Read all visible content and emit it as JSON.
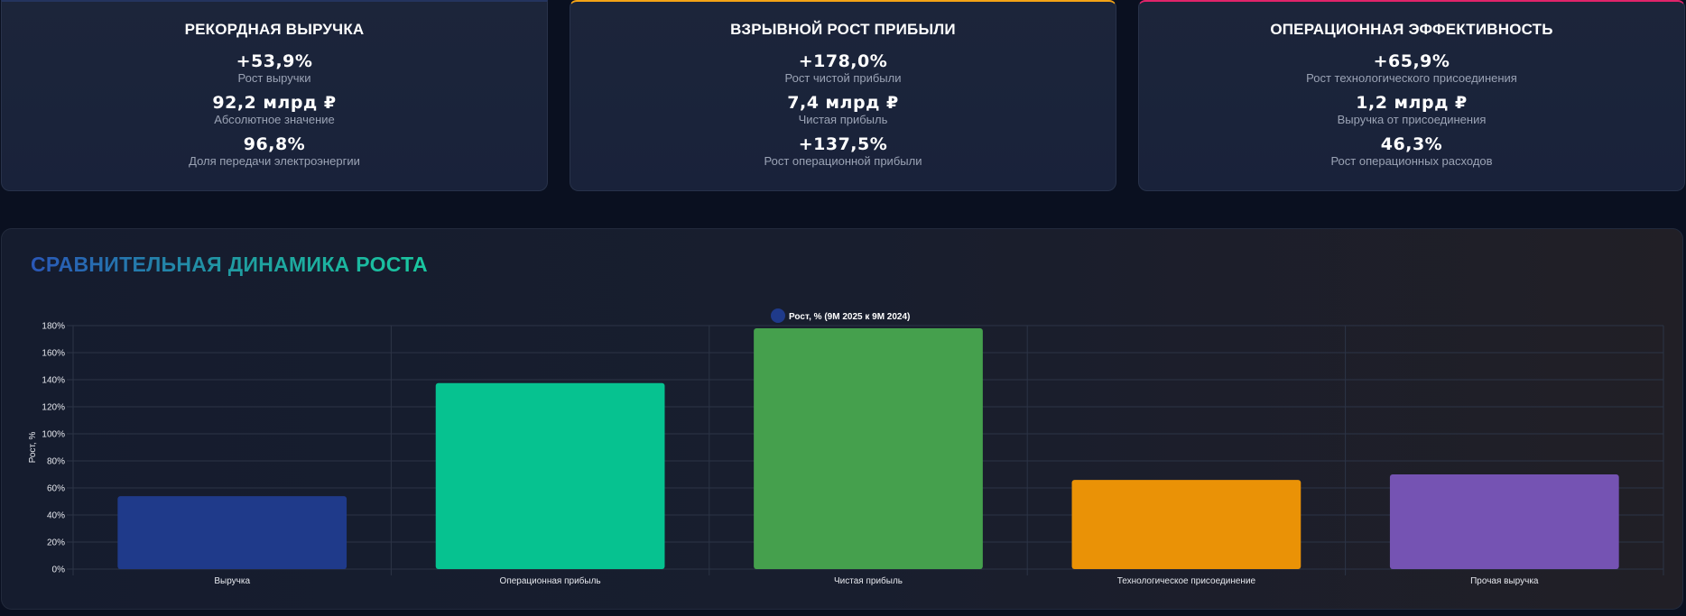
{
  "cards": [
    {
      "title": "РЕКОРДНАЯ ВЫРУЧКА",
      "accent": "#24345e",
      "metrics": [
        {
          "value": "+53,9%",
          "label": "Рост выручки"
        },
        {
          "value": "92,2 млрд ₽",
          "label": "Абсолютное значение"
        },
        {
          "value": "96,8%",
          "label": "Доля передачи электроэнергии"
        }
      ]
    },
    {
      "title": "ВЗРЫВНОЙ РОСТ ПРИБЫЛИ",
      "accent": "#f3a316",
      "metrics": [
        {
          "value": "+178,0%",
          "label": "Рост чистой прибыли"
        },
        {
          "value": "7,4 млрд ₽",
          "label": "Чистая прибыль"
        },
        {
          "value": "+137,5%",
          "label": "Рост операционной прибыли"
        }
      ]
    },
    {
      "title": "ОПЕРАЦИОННАЯ ЭФФЕКТИВНОСТЬ",
      "accent": "#e0246a",
      "metrics": [
        {
          "value": "+65,9%",
          "label": "Рост технологического присоединения"
        },
        {
          "value": "1,2 млрд ₽",
          "label": "Выручка от присоединения"
        },
        {
          "value": "46,3%",
          "label": "Рост операционных расходов"
        }
      ]
    }
  ],
  "panel": {
    "title": "СРАВНИТЕЛЬНАЯ ДИНАМИКА РОСТА"
  },
  "chart_data": {
    "type": "bar",
    "categories": [
      "Выручка",
      "Операционная прибыль",
      "Чистая прибыль",
      "Технологическое присоединение",
      "Прочая выручка"
    ],
    "series": [
      {
        "name": "Рост, % (9М 2025 к 9М 2024)",
        "values": [
          53.9,
          137.5,
          178.0,
          65.9,
          70.0
        ],
        "colors": [
          "#1f3a8a",
          "#06c290",
          "#45a04d",
          "#ea9206",
          "#7553b3"
        ]
      }
    ],
    "ylabel": "Рост, %",
    "xlabel": "",
    "ylim": [
      0,
      180
    ],
    "yticks": [
      0,
      20,
      40,
      60,
      80,
      100,
      120,
      140,
      160,
      180
    ],
    "ytick_suffix": "%",
    "grid": true,
    "legend_position": "top-center",
    "legend_color": "#1f3a8a"
  }
}
